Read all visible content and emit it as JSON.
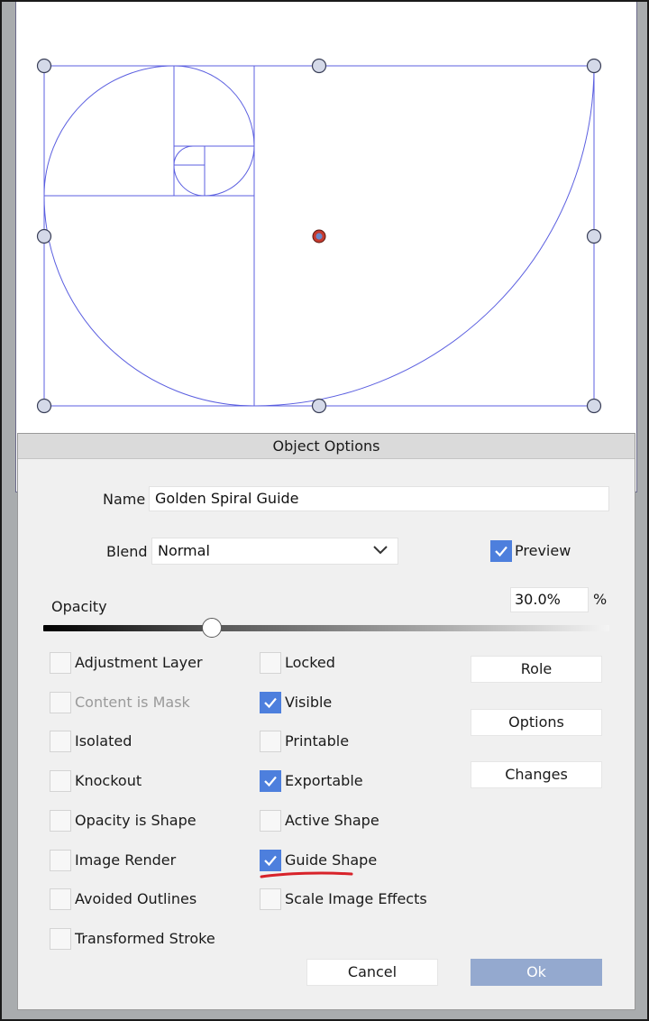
{
  "dialog": {
    "title": "Object Options",
    "name_label": "Name",
    "name_value": "Golden Spiral Guide",
    "blend_label": "Blend",
    "blend_value": "Normal",
    "preview_label": "Preview",
    "preview_checked": true,
    "opacity_label": "Opacity",
    "opacity_value": "30.0%",
    "opacity_fraction": 0.3,
    "opacity_unit": "%"
  },
  "options_left": [
    {
      "label": "Adjustment Layer",
      "checked": false,
      "disabled": false
    },
    {
      "label": "Content is Mask",
      "checked": false,
      "disabled": true
    },
    {
      "label": "Isolated",
      "checked": false,
      "disabled": false
    },
    {
      "label": "Knockout",
      "checked": false,
      "disabled": false
    },
    {
      "label": "Opacity is Shape",
      "checked": false,
      "disabled": false
    },
    {
      "label": "Image Render",
      "checked": false,
      "disabled": false
    },
    {
      "label": "Avoided Outlines",
      "checked": false,
      "disabled": false
    },
    {
      "label": "Transformed Stroke",
      "checked": false,
      "disabled": false
    }
  ],
  "options_right": [
    {
      "label": "Locked",
      "checked": false
    },
    {
      "label": "Visible",
      "checked": true
    },
    {
      "label": "Printable",
      "checked": false
    },
    {
      "label": "Exportable",
      "checked": true
    },
    {
      "label": "Active Shape",
      "checked": false
    },
    {
      "label": "Guide Shape",
      "checked": true
    },
    {
      "label": "Scale Image Effects",
      "checked": false
    }
  ],
  "side_buttons": {
    "role": "Role",
    "options": "Options",
    "changes": "Changes"
  },
  "footer": {
    "cancel": "Cancel",
    "ok": "Ok"
  },
  "colors": {
    "guide_stroke": "#5b5fe0",
    "checkbox_accent": "#4d7fdd",
    "annotation": "#d8232a",
    "ok_button": "#94a9cf"
  }
}
